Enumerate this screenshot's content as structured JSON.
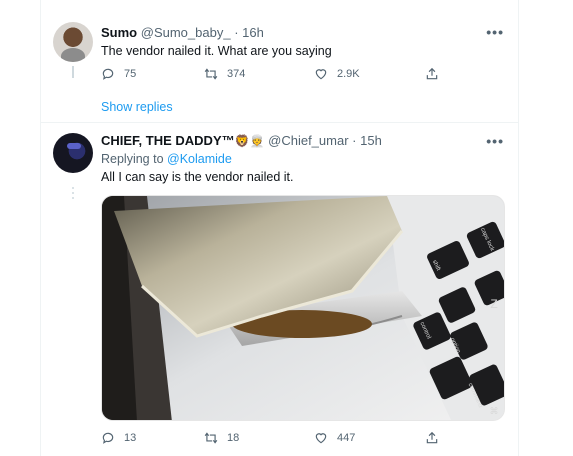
{
  "tweets": [
    {
      "name": "Sumo",
      "handle": "@Sumo_baby_",
      "separator": "·",
      "time": "16h",
      "text": "The vendor nailed it. What are you saying",
      "stats": {
        "replies": "75",
        "retweets": "374",
        "likes": "2.9K"
      }
    },
    {
      "name": "CHIEF, THE DADDY™",
      "name_emoji": "🦁👳",
      "handle": "@Chief_umar",
      "separator": "·",
      "time": "15h",
      "replying_prefix": "Replying to",
      "replying_to": "@Kolamide",
      "text": "All I can say is the vendor nailed it.",
      "stats": {
        "replies": "13",
        "retweets": "18",
        "likes": "447"
      }
    }
  ],
  "thread": {
    "show_replies": "Show replies"
  },
  "more_label": "•••",
  "keyboard_keys": [
    "caps lock",
    "shift",
    "control",
    "option",
    "command",
    "Z",
    "⌘"
  ],
  "icons": {
    "reply": "reply-icon",
    "retweet": "retweet-icon",
    "like": "heart-icon",
    "share": "share-icon",
    "more": "more-icon"
  },
  "colors": {
    "link": "#1d9bf0",
    "muted": "#536471",
    "text": "#0f1419"
  }
}
